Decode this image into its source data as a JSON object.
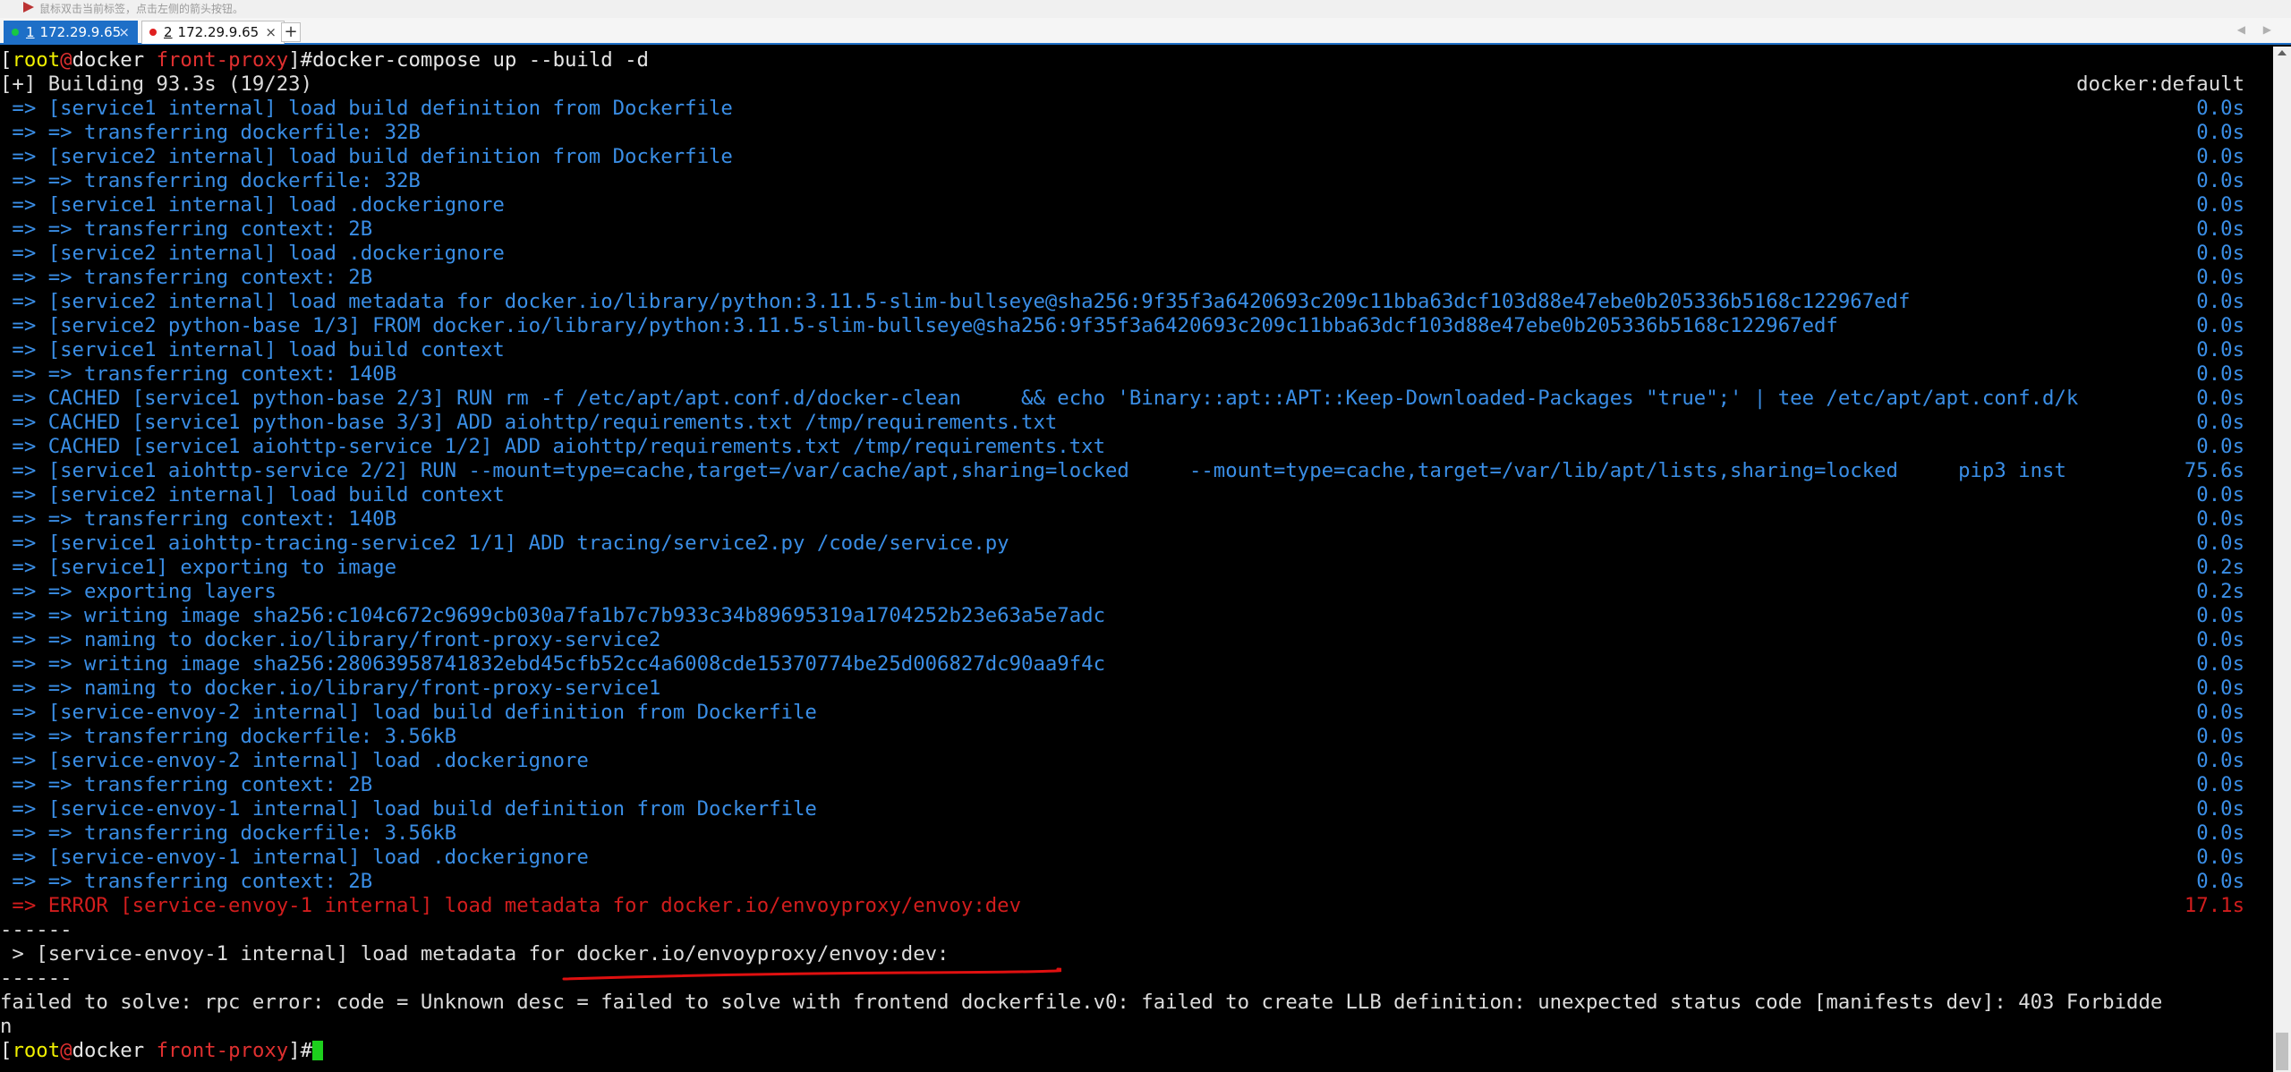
{
  "hint": {
    "text": "鼠标双击当前标签，点击左侧的箭头按钮。"
  },
  "tabs": [
    {
      "num": "1",
      "label": "172.29.9.65",
      "close": "×",
      "active": true
    },
    {
      "num": "2",
      "label": "172.29.9.65",
      "close": "×",
      "active": false
    }
  ],
  "new_tab_label": "+",
  "tab_nav": "◀ ▶",
  "prompt": {
    "open": "[",
    "user": "root",
    "at": "@",
    "host": "docker",
    "dir": "front-proxy",
    "close": "]#"
  },
  "command": "docker-compose up --build -d",
  "build_header": {
    "text": "[+] Building 93.3s (19/23)",
    "context": "docker:default"
  },
  "steps": [
    {
      "text": " => [service1 internal] load build definition from Dockerfile",
      "dur": "0.0s"
    },
    {
      "text": " => => transferring dockerfile: 32B",
      "dur": "0.0s"
    },
    {
      "text": " => [service2 internal] load build definition from Dockerfile",
      "dur": "0.0s"
    },
    {
      "text": " => => transferring dockerfile: 32B",
      "dur": "0.0s"
    },
    {
      "text": " => [service1 internal] load .dockerignore",
      "dur": "0.0s"
    },
    {
      "text": " => => transferring context: 2B",
      "dur": "0.0s"
    },
    {
      "text": " => [service2 internal] load .dockerignore",
      "dur": "0.0s"
    },
    {
      "text": " => => transferring context: 2B",
      "dur": "0.0s"
    },
    {
      "text": " => [service2 internal] load metadata for docker.io/library/python:3.11.5-slim-bullseye@sha256:9f35f3a6420693c209c11bba63dcf103d88e47ebe0b205336b5168c122967edf",
      "dur": "0.0s"
    },
    {
      "text": " => [service2 python-base 1/3] FROM docker.io/library/python:3.11.5-slim-bullseye@sha256:9f35f3a6420693c209c11bba63dcf103d88e47ebe0b205336b5168c122967edf",
      "dur": "0.0s"
    },
    {
      "text": " => [service1 internal] load build context",
      "dur": "0.0s"
    },
    {
      "text": " => => transferring context: 140B",
      "dur": "0.0s"
    },
    {
      "text": " => CACHED [service1 python-base 2/3] RUN rm -f /etc/apt/apt.conf.d/docker-clean     && echo 'Binary::apt::APT::Keep-Downloaded-Packages \"true\";' | tee /etc/apt/apt.conf.d/k",
      "dur": "0.0s"
    },
    {
      "text": " => CACHED [service1 python-base 3/3] ADD aiohttp/requirements.txt /tmp/requirements.txt",
      "dur": "0.0s"
    },
    {
      "text": " => CACHED [service1 aiohttp-service 1/2] ADD aiohttp/requirements.txt /tmp/requirements.txt",
      "dur": "0.0s"
    },
    {
      "text": " => [service1 aiohttp-service 2/2] RUN --mount=type=cache,target=/var/cache/apt,sharing=locked     --mount=type=cache,target=/var/lib/apt/lists,sharing=locked     pip3 inst",
      "dur": "75.6s"
    },
    {
      "text": " => [service2 internal] load build context",
      "dur": "0.0s"
    },
    {
      "text": " => => transferring context: 140B",
      "dur": "0.0s"
    },
    {
      "text": " => [service1 aiohttp-tracing-service2 1/1] ADD tracing/service2.py /code/service.py",
      "dur": "0.0s"
    },
    {
      "text": " => [service1] exporting to image",
      "dur": "0.2s"
    },
    {
      "text": " => => exporting layers",
      "dur": "0.2s"
    },
    {
      "text": " => => writing image sha256:c104c672c9699cb030a7fa1b7c7b933c34b89695319a1704252b23e63a5e7adc",
      "dur": "0.0s"
    },
    {
      "text": " => => naming to docker.io/library/front-proxy-service2",
      "dur": "0.0s"
    },
    {
      "text": " => => writing image sha256:28063958741832ebd45cfb52cc4a6008cde15370774be25d006827dc90aa9f4c",
      "dur": "0.0s"
    },
    {
      "text": " => => naming to docker.io/library/front-proxy-service1",
      "dur": "0.0s"
    },
    {
      "text": " => [service-envoy-2 internal] load build definition from Dockerfile",
      "dur": "0.0s"
    },
    {
      "text": " => => transferring dockerfile: 3.56kB",
      "dur": "0.0s"
    },
    {
      "text": " => [service-envoy-2 internal] load .dockerignore",
      "dur": "0.0s"
    },
    {
      "text": " => => transferring context: 2B",
      "dur": "0.0s"
    },
    {
      "text": " => [service-envoy-1 internal] load build definition from Dockerfile",
      "dur": "0.0s"
    },
    {
      "text": " => => transferring dockerfile: 3.56kB",
      "dur": "0.0s"
    },
    {
      "text": " => [service-envoy-1 internal] load .dockerignore",
      "dur": "0.0s"
    },
    {
      "text": " => => transferring context: 2B",
      "dur": "0.0s"
    }
  ],
  "error_step": {
    "text": " => ERROR [service-envoy-1 internal] load metadata for docker.io/envoyproxy/envoy:dev",
    "dur": "17.1s"
  },
  "separator": "------",
  "detail_line": " > [service-envoy-1 internal] load metadata for docker.io/envoyproxy/envoy:dev:",
  "failure": {
    "line1": "failed to solve: rpc error: code = Unknown desc = failed to solve with frontend dockerfile.v0: failed to create LLB definition: unexpected status code [manifests dev]: 403 Forbidde",
    "line2": "n"
  },
  "colors": {
    "step": "#3a8ee6",
    "error": "#d21d1d",
    "annotation": "#e01010",
    "cursor": "#1dd01d"
  }
}
